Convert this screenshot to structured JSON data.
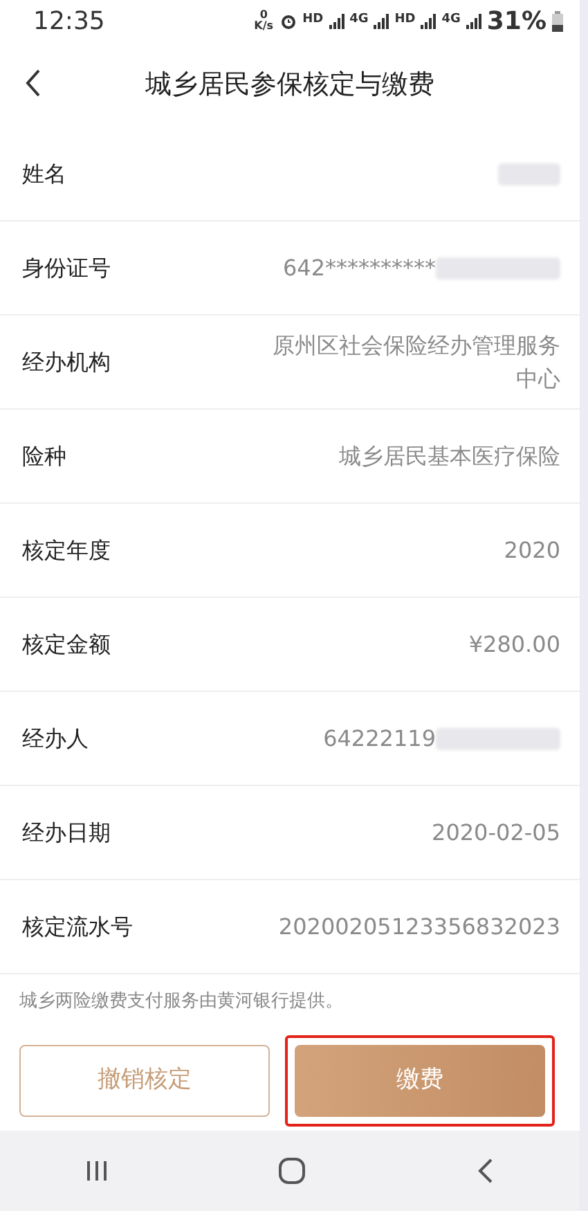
{
  "status_bar": {
    "time": "12:35",
    "speed_value": "0",
    "speed_unit": "K/s",
    "network_labels": [
      "HD",
      "4G",
      "HD",
      "4G"
    ],
    "battery": "31%"
  },
  "header": {
    "title": "城乡居民参保核定与缴费"
  },
  "rows": [
    {
      "label": "姓名",
      "redacted": true
    },
    {
      "label": "身份证号",
      "value": "642**********",
      "redacted": true
    },
    {
      "label": "经办机构",
      "value": "原州区社会保险经办管理服务中心",
      "redacted": false
    },
    {
      "label": "险种",
      "value": "城乡居民基本医疗保险",
      "redacted": false
    },
    {
      "label": "核定年度",
      "value": "2020",
      "redacted": false
    },
    {
      "label": "核定金额",
      "value": "¥280.00",
      "redacted": false
    },
    {
      "label": "经办人",
      "value": "64222119",
      "redacted": true
    },
    {
      "label": "经办日期",
      "value": "2020-02-05",
      "redacted": false
    },
    {
      "label": "核定流水号",
      "value": "20200205123356832023",
      "redacted": false
    }
  ],
  "note": "城乡两险缴费支付服务由黄河银行提供。",
  "buttons": [
    {
      "label": "撤销核定",
      "kind": "outline",
      "highlighted": false
    },
    {
      "label": "缴费",
      "kind": "filled",
      "highlighted": true
    }
  ]
}
